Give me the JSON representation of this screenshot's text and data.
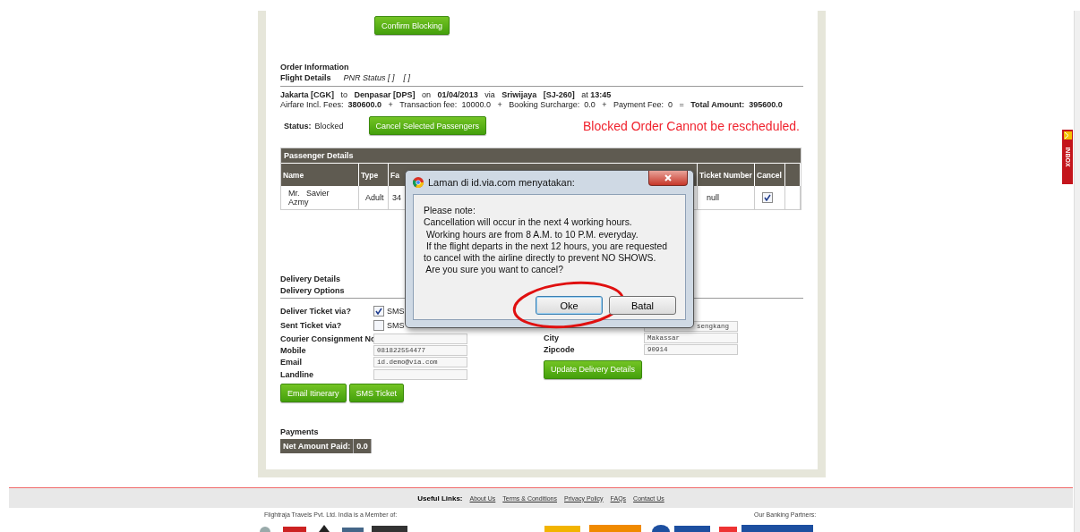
{
  "top_button": "Confirm Blocking",
  "order": {
    "title": "Order Information",
    "flight_details_label": "Flight Details",
    "pnr_status": "PNR Status [ ]    [ ]",
    "flight_line": "**Jakarta [CGK]**   to   **Denpasar [DPS]**   on   **01/04/2013**   via   **Sriwijaya**   **[SJ-260]**   at **13:45**",
    "fees_line": "Airfare Incl. Fees:  **380600.0**   +   Transaction fee:  10000.0   +   Booking Surcharge:  0.0   +   Payment Fee:  0   =   **Total Amount:  395600.0**"
  },
  "status": {
    "label": "Status:",
    "value": "Blocked",
    "button": "Cancel Selected Passengers",
    "warning": "Blocked Order Cannot be rescheduled."
  },
  "passengers": {
    "title": "Passenger Details",
    "columns": [
      "Name",
      "Type",
      "Fa",
      "Ticket Number",
      "Cancel"
    ],
    "rows": [
      {
        "name": "Mr.   Savier Azmy",
        "type": "Adult",
        "column_3": "34",
        "ticket_number": "null",
        "cancel": true
      }
    ]
  },
  "delivery": {
    "title": "Delivery Details",
    "subtitle": "Delivery Options",
    "left": [
      {
        "kind": "checkbox",
        "label": "Deliver Ticket via?",
        "option": "SMS",
        "checked": true
      },
      {
        "kind": "checkbox",
        "label": "Sent Ticket via?",
        "option": "SMS",
        "checked": false
      },
      {
        "kind": "field",
        "label": "Courier Consignment No"
      },
      {
        "kind": "field",
        "label": "Mobile",
        "value": "081822554477"
      },
      {
        "kind": "field",
        "label": "Email",
        "value": "id.demo@via.com"
      },
      {
        "kind": "field",
        "label": "Landline"
      }
    ],
    "right": [
      {
        "value": "sengkang"
      },
      {
        "label": "City",
        "value": "Makassar"
      },
      {
        "label": "Zipcode",
        "value": "90914"
      }
    ],
    "buttons": [
      "Email Itinerary",
      "SMS Ticket"
    ],
    "update_button": "Update Delivery Details"
  },
  "payments": {
    "title": "Payments",
    "label": "Net Amount Paid:",
    "value": "0.0"
  },
  "dialog": {
    "title": "Laman di id.via.com menyatakan:",
    "message": "Please note:\nCancellation will occur in the next 4 working hours.\n Working hours are from 8 A.M. to 10 P.M. everyday.\n If the flight departs in the next 12 hours, you are requested\nto cancel with the airline directly to prevent NO SHOWS.\n Are you sure you want to cancel?",
    "buttons": [
      {
        "label": "Oke",
        "focused": true,
        "circled": true
      },
      {
        "label": "Batal",
        "focused": false,
        "circled": false
      }
    ]
  },
  "footer": {
    "links_label": "Useful Links:",
    "links": [
      "About Us",
      "Terms & Conditions",
      "Privacy Policy",
      "FAQs",
      "Contact Us"
    ],
    "member_text": "Flightraja Travels Pvt. Ltd. India is a Member of:",
    "banking_text": "Our Banking Partners:"
  },
  "inbox_tab": "INBOX"
}
